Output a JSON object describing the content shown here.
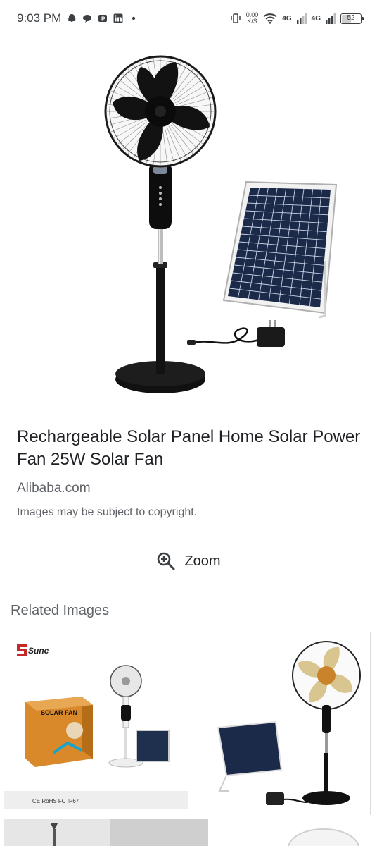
{
  "status_bar": {
    "time": "9:03 PM",
    "net_speed_value": "0.00",
    "net_speed_unit": "K/S",
    "sim1": "4G",
    "sim2": "4G",
    "battery": "52",
    "battery_level": 0.52
  },
  "result": {
    "title": "Rechargeable Solar Panel Home Solar Power Fan 25W Solar Fan",
    "source": "Alibaba.com",
    "copyright": "Images may be subject to copyright."
  },
  "zoom": {
    "label": "Zoom",
    "icon": "zoom-in-icon"
  },
  "related": {
    "title": "Related Images",
    "items": [
      {
        "brand": "Sunc",
        "box_label": "SOLAR FAN",
        "certs": "CE RoHS FC IP67"
      },
      {
        "brand": ""
      },
      {
        "brand": ""
      },
      {
        "brand": ""
      }
    ]
  },
  "colors": {
    "text": "#202124",
    "secondary": "#5f6368",
    "accent_red": "#c62828"
  }
}
